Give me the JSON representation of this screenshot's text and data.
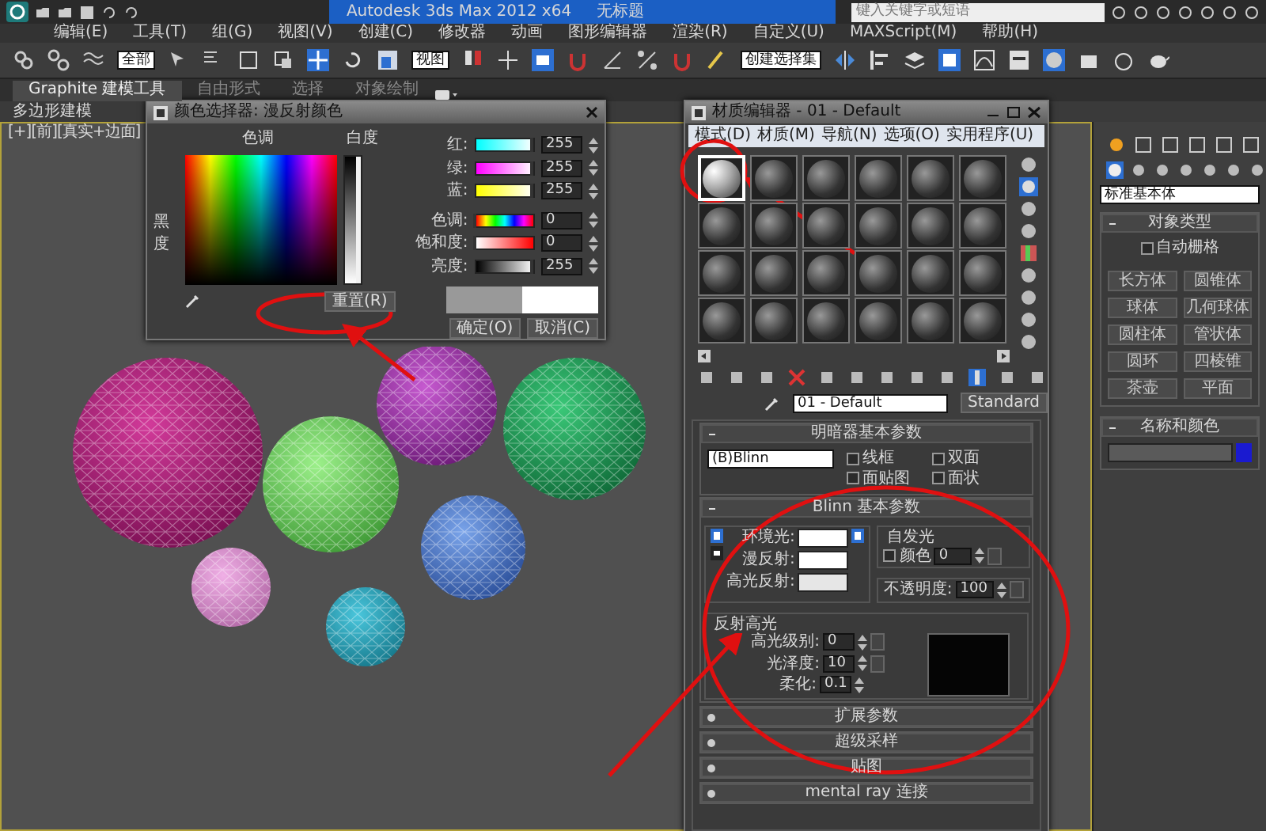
{
  "title_bar": {
    "app": "Autodesk 3ds Max  2012 x64",
    "document": "无标题",
    "search": {
      "placeholder": "键入关键字或短语"
    }
  },
  "menu": [
    "编辑(E)",
    "工具(T)",
    "组(G)",
    "视图(V)",
    "创建(C)",
    "修改器",
    "动画",
    "图形编辑器",
    "渲染(R)",
    "自定义(U)",
    "MAXScript(M)",
    "帮助(H)"
  ],
  "toolbar": {
    "selection_filter": "全部",
    "reference_coordinate": "视图",
    "named_selection_set": "创建选择集"
  },
  "ribbon_tabs": [
    {
      "label": "Graphite 建模工具",
      "selected": true
    },
    {
      "label": "自由形式",
      "selected": false
    },
    {
      "label": "选择",
      "selected": false
    },
    {
      "label": "对象绘制",
      "selected": false
    }
  ],
  "ribbon_panel": {
    "label": "多边形建模"
  },
  "viewport": {
    "label": "[+][前][真实+边面]"
  },
  "color_picker": {
    "title": "颜色选择器: 漫反射颜色",
    "hue_label": "色调",
    "whiteness": {
      "label": "白度",
      "level": 1
    },
    "blackness_label": "黑度",
    "channels": [
      {
        "kind": "red",
        "label": "红:",
        "value": "255",
        "level": 1
      },
      {
        "kind": "green",
        "label": "绿:",
        "value": "255",
        "level": 1
      },
      {
        "kind": "blue",
        "label": "蓝:",
        "value": "255",
        "level": 1
      },
      {
        "kind": "hue",
        "label": "色调:",
        "value": "0",
        "level": 0
      },
      {
        "kind": "saturation",
        "label": "饱和度:",
        "value": "0",
        "level": 0
      },
      {
        "kind": "value",
        "label": "亮度:",
        "value": "255",
        "level": 1
      }
    ],
    "reset_button": "重置(R)",
    "buttons": [
      "确定(O)",
      "取消(C)"
    ]
  },
  "material_editor": {
    "title": "材质编辑器 - 01 - Default",
    "menu": [
      "模式(D)",
      "材质(M)",
      "导航(N)",
      "选项(O)",
      "实用程序(U)"
    ],
    "slots": [
      {
        "selected": true
      },
      {
        "selected": false
      },
      {
        "selected": false
      },
      {
        "selected": false
      },
      {
        "selected": false
      },
      {
        "selected": false
      },
      {
        "selected": false
      },
      {
        "selected": false
      },
      {
        "selected": false
      },
      {
        "selected": false
      },
      {
        "selected": false
      },
      {
        "selected": false
      },
      {
        "selected": false
      },
      {
        "selected": false
      },
      {
        "selected": false
      },
      {
        "selected": false
      },
      {
        "selected": false
      },
      {
        "selected": false
      },
      {
        "selected": false
      },
      {
        "selected": false
      },
      {
        "selected": false
      },
      {
        "selected": false
      },
      {
        "selected": false
      },
      {
        "selected": false
      }
    ],
    "material_name": "01 - Default",
    "material_type": "Standard",
    "rollouts": [
      {
        "kind": "shader",
        "title": "明暗器基本参数",
        "expanded": true,
        "shader": "(B)Blinn",
        "options": [
          {
            "label": "线框",
            "checked": false
          },
          {
            "label": "双面",
            "checked": false
          },
          {
            "label": "面贴图",
            "checked": false
          },
          {
            "label": "面状",
            "checked": false
          }
        ]
      },
      {
        "kind": "blinn",
        "title": "Blinn 基本参数",
        "expanded": true,
        "colors": [
          {
            "label": "环境光:",
            "color": "#ffffff"
          },
          {
            "label": "漫反射:",
            "color": "#ffffff"
          },
          {
            "label": "高光反射:",
            "color": "#e6e6e6"
          }
        ],
        "self_illum": {
          "title": "自发光",
          "label": "颜色",
          "checked": false,
          "value": "0"
        },
        "opacity": {
          "label": "不透明度:",
          "value": "100"
        },
        "highlights": {
          "title": "反射高光",
          "fields": [
            {
              "label": "高光级别:",
              "value": "0"
            },
            {
              "label": "光泽度:",
              "value": "10"
            },
            {
              "label": "柔化:",
              "value": "0.1"
            }
          ]
        }
      },
      {
        "kind": "plain",
        "title": "扩展参数",
        "expanded": false
      },
      {
        "kind": "plain",
        "title": "超级采样",
        "expanded": false
      },
      {
        "kind": "plain",
        "title": "贴图",
        "expanded": false
      },
      {
        "kind": "plain",
        "title": "mental ray 连接",
        "expanded": false
      }
    ]
  },
  "command_panel": {
    "primitive_type": "标准基本体",
    "object_type": {
      "title": "对象类型",
      "auto_grid": {
        "label": "自动栅格",
        "checked": false
      },
      "buttons": [
        "长方体",
        "圆锥体",
        "球体",
        "几何球体",
        "圆柱体",
        "管状体",
        "圆环",
        "四棱锥",
        "茶壶",
        "平面"
      ]
    },
    "name_and_color": {
      "title": "名称和颜色",
      "color": "#1a1ad0"
    }
  }
}
